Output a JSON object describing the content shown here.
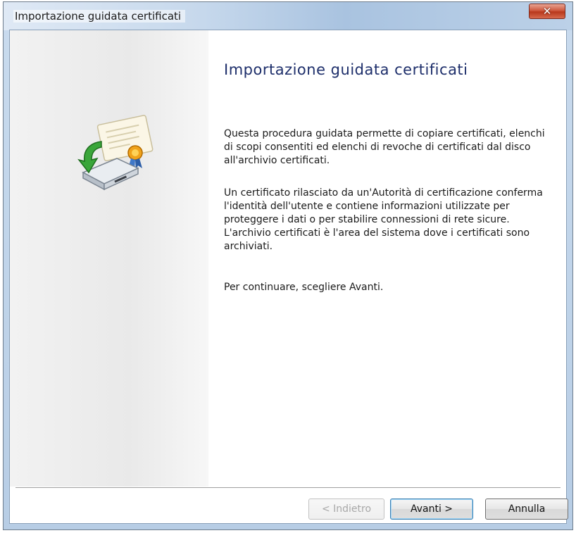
{
  "window": {
    "title": "Importazione guidata certificati",
    "close_label": "✕"
  },
  "wizard": {
    "heading": "Importazione guidata certificati",
    "paragraphs": [
      "Questa procedura guidata permette di copiare certificati, elenchi di scopi consentiti ed elenchi di revoche di certificati dal disco all'archivio certificati.",
      "Un certificato rilasciato da un'Autorità di certificazione conferma l'identità dell'utente e contiene informazioni utilizzate per proteggere i dati o per stabilire connessioni di rete sicure. L'archivio certificati è l'area del sistema dove i certificati sono archiviati.",
      "Per continuare, scegliere Avanti."
    ],
    "icon": "certificate-import-icon"
  },
  "buttons": {
    "back": "< Indietro",
    "next": "Avanti >",
    "cancel": "Annulla"
  },
  "colors": {
    "heading": "#1e2f6b",
    "titlebar": "#c6d8ec",
    "close": "#c7472a",
    "default_button_border": "#3c7fb1"
  }
}
